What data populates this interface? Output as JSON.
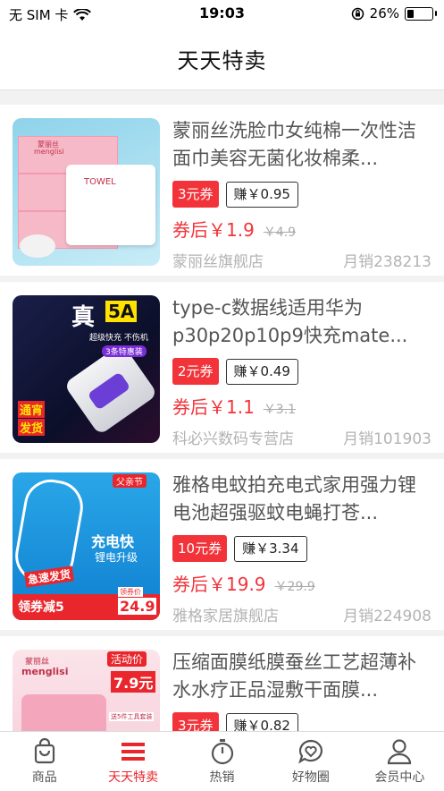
{
  "status": {
    "carrier": "无 SIM 卡",
    "time": "19:03",
    "battery_percent": "26%",
    "battery_level": 0.26
  },
  "header": {
    "title": "天天特卖"
  },
  "products": [
    {
      "title": "蒙丽丝洗脸巾女纯棉一次性洁面巾美容无菌化妆棉柔...",
      "coupon": "3元券",
      "earn": "赚￥0.95",
      "price_after": "券后￥1.9",
      "price_original": "￥4.9",
      "shop": "蒙丽丝旗舰店",
      "sales": "月销238213",
      "thumb_texts": [
        "蒙丽丝",
        "menglisi",
        "TOWEL"
      ]
    },
    {
      "title": "type-c数据线适用华为p30p20p10p9快充mate...",
      "coupon": "2元券",
      "earn": "赚￥0.49",
      "price_after": "券后￥1.1",
      "price_original": "￥3.1",
      "shop": "科必兴数码专营店",
      "sales": "月销101903",
      "thumb_texts": [
        "真",
        "5A",
        "超级快充 不伤机",
        "3条特惠装",
        "通宵",
        "发货"
      ]
    },
    {
      "title": "雅格电蚊拍充电式家用强力锂电池超强驱蚊电蝇打苍...",
      "coupon": "10元券",
      "earn": "赚￥3.34",
      "price_after": "券后￥19.9",
      "price_original": "￥29.9",
      "shop": "雅格家居旗舰店",
      "sales": "月销224908",
      "thumb_texts": [
        "父亲节",
        "充电快",
        "锂电升级",
        "急速发货",
        "领券减5",
        "领券价",
        "24.9"
      ]
    },
    {
      "title": "压缩面膜纸膜蚕丝工艺超薄补水水疗正品湿敷干面膜...",
      "coupon": "3元券",
      "earn": "赚￥0.82",
      "price_after": "",
      "price_original": "",
      "shop": "",
      "sales": "",
      "thumb_texts": [
        "蒙丽丝",
        "menglisi",
        "活动价",
        "7.9元",
        "送5件工具套装"
      ]
    }
  ],
  "tabs": [
    {
      "label": "商品",
      "icon": "bag-icon",
      "active": false
    },
    {
      "label": "天天特卖",
      "icon": "menu-icon",
      "active": true
    },
    {
      "label": "热销",
      "icon": "stopwatch-icon",
      "active": false
    },
    {
      "label": "好物圈",
      "icon": "chat-heart-icon",
      "active": false
    },
    {
      "label": "会员中心",
      "icon": "user-icon",
      "active": false
    }
  ],
  "colors": {
    "accent": "#e8262c",
    "coupon_bg": "#f2343a"
  }
}
